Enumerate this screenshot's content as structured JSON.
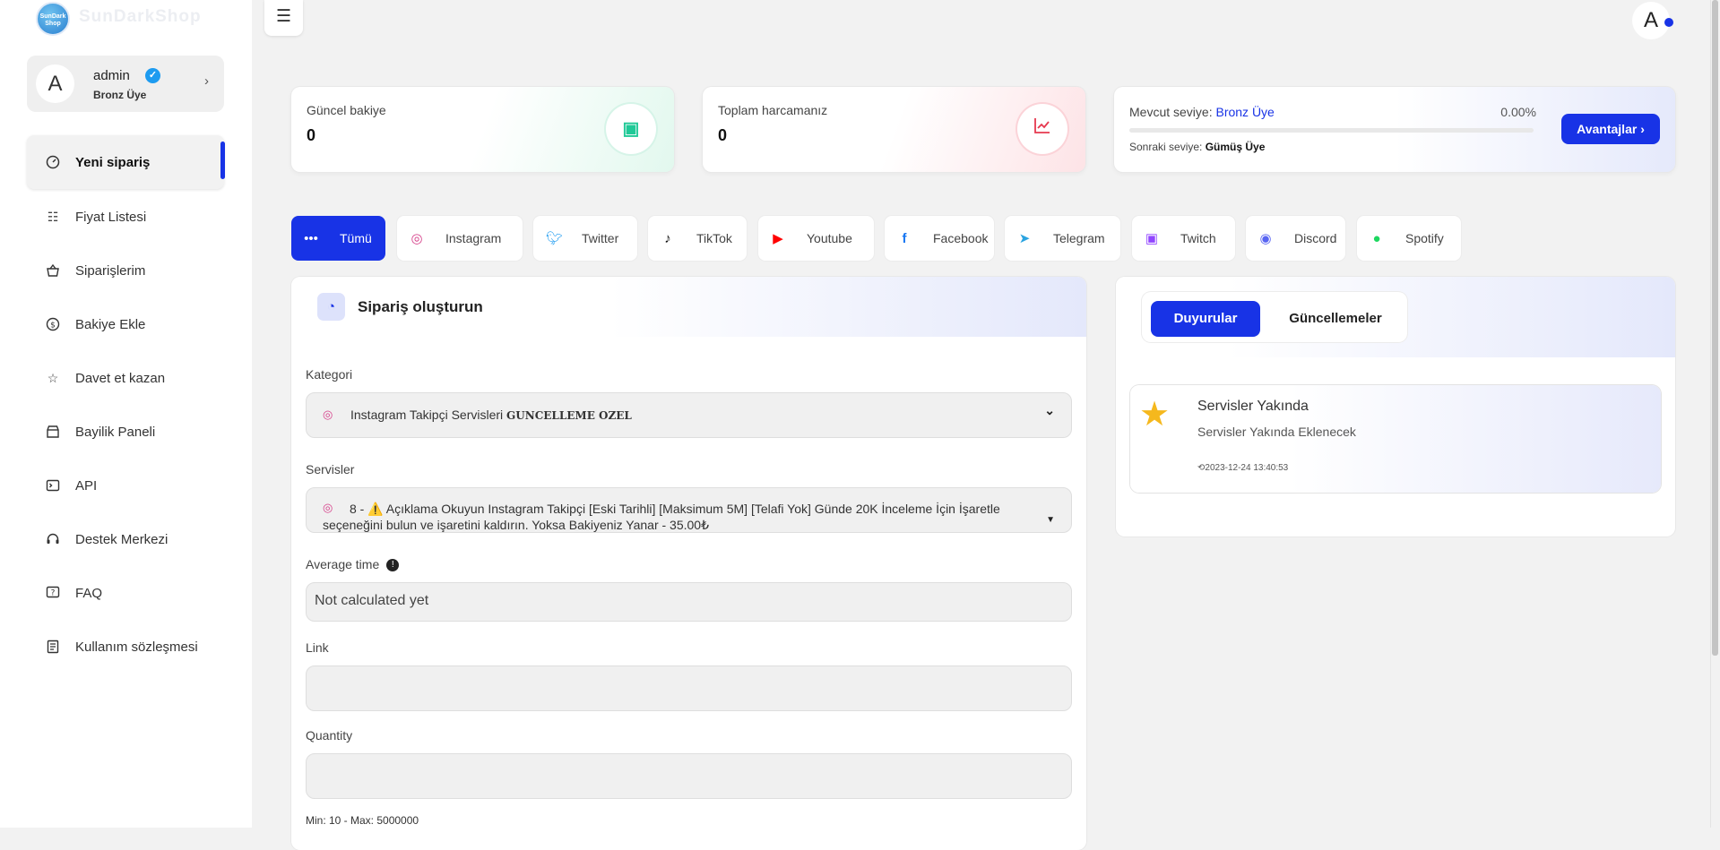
{
  "brand": {
    "logo_text": "SunDark Shop",
    "name": "SunDarkShop"
  },
  "profile": {
    "avatar": "A",
    "name": "admin",
    "rank": "Bronz Üye"
  },
  "sidebar": {
    "items": [
      {
        "label": "Yeni sipariş",
        "icon": "speedometer-icon"
      },
      {
        "label": "Fiyat Listesi",
        "icon": "list-icon"
      },
      {
        "label": "Siparişlerim",
        "icon": "basket-icon"
      },
      {
        "label": "Bakiye Ekle",
        "icon": "coin-icon"
      },
      {
        "label": "Davet et kazan",
        "icon": "star-icon"
      },
      {
        "label": "Bayilik Paneli",
        "icon": "store-icon"
      },
      {
        "label": "API",
        "icon": "terminal-icon"
      },
      {
        "label": "Destek Merkezi",
        "icon": "headset-icon"
      },
      {
        "label": "FAQ",
        "icon": "question-icon"
      },
      {
        "label": "Kullanım sözleşmesi",
        "icon": "document-icon"
      }
    ]
  },
  "topbar": {
    "avatar": "A"
  },
  "stats": {
    "balance": {
      "label": "Güncel bakiye",
      "value": "0"
    },
    "spent": {
      "label": "Toplam harcamanız",
      "value": "0"
    },
    "level": {
      "label": "Mevcut seviye:",
      "current": "Bronz Üye",
      "percent": "0.00%",
      "progress": 0,
      "next_label": "Sonraki seviye:",
      "next": "Gümüş Üye",
      "button": "Avantajlar ›"
    }
  },
  "platform_tabs": [
    {
      "label": "Tümü",
      "icon": "dots-icon",
      "color": "#ffffff"
    },
    {
      "label": "Instagram",
      "icon": "instagram-icon",
      "color": "#d6408a"
    },
    {
      "label": "Twitter",
      "icon": "twitter-icon",
      "color": "#1d9bf0"
    },
    {
      "label": "TikTok",
      "icon": "tiktok-icon",
      "color": "#111111"
    },
    {
      "label": "Youtube",
      "icon": "youtube-icon",
      "color": "#ff0000"
    },
    {
      "label": "Facebook",
      "icon": "facebook-icon",
      "color": "#1877f2"
    },
    {
      "label": "Telegram",
      "icon": "telegram-icon",
      "color": "#2aa3e0"
    },
    {
      "label": "Twitch",
      "icon": "twitch-icon",
      "color": "#9146ff"
    },
    {
      "label": "Discord",
      "icon": "discord-icon",
      "color": "#5865f2"
    },
    {
      "label": "Spotify",
      "icon": "spotify-icon",
      "color": "#1ed760"
    }
  ],
  "order": {
    "title": "Sipariş oluşturun",
    "category_label": "Kategori",
    "category_value": "Instagram Takipçi Servisleri",
    "category_tag": "GUNCELLEME OZEL",
    "service_label": "Servisler",
    "service_value": "8 - ⚠️ Açıklama Okuyun Instagram Takipçi [Eski Tarihli] [Maksimum 5M] [Telafi Yok] Günde 20K İnceleme İçin İşaretle seçeneğini bulun ve işaretini kaldırın. Yoksa Bakiyeniz Yanar - 35.00₺",
    "avg_label": "Average time",
    "avg_value": "Not calculated yet",
    "link_label": "Link",
    "quantity_label": "Quantity",
    "minmax": "Min: 10 - Max: 5000000"
  },
  "announcements": {
    "tabs": [
      "Duyurular",
      "Güncellemeler"
    ],
    "item": {
      "title": "Servisler Yakında",
      "text": "Servisler Yakında Eklenecek",
      "date": "2023-12-24 13:40:53"
    }
  }
}
